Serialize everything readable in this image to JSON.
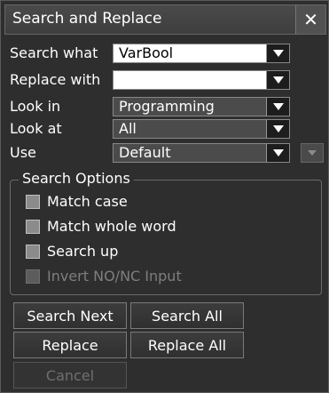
{
  "window": {
    "title": "Search and Replace",
    "close_label": "✕"
  },
  "fields": {
    "search_what": {
      "label": "Search what",
      "value": "VarBool"
    },
    "replace_with": {
      "label": "Replace with",
      "value": ""
    },
    "look_in": {
      "label": "Look in",
      "value": "Programming"
    },
    "look_at": {
      "label": "Look at",
      "value": "All"
    },
    "use": {
      "label": "Use",
      "value": "Default"
    }
  },
  "search_options": {
    "title": "Search Options",
    "items": [
      {
        "label": "Match case",
        "checked": false,
        "enabled": true
      },
      {
        "label": "Match whole word",
        "checked": false,
        "enabled": true
      },
      {
        "label": "Search up",
        "checked": false,
        "enabled": true
      },
      {
        "label": "Invert NO/NC Input",
        "checked": false,
        "enabled": false
      }
    ]
  },
  "buttons": {
    "search_next": "Search Next",
    "search_all": "Search All",
    "replace": "Replace",
    "replace_all": "Replace All",
    "cancel": "Cancel"
  },
  "icons": {
    "dropdown": "chevron-down-icon",
    "close": "close-icon"
  },
  "colors": {
    "background": "#2e2e2e",
    "title_bar": "#444444",
    "field_white": "#ffffff",
    "field_dark": "#4b4b4b"
  }
}
